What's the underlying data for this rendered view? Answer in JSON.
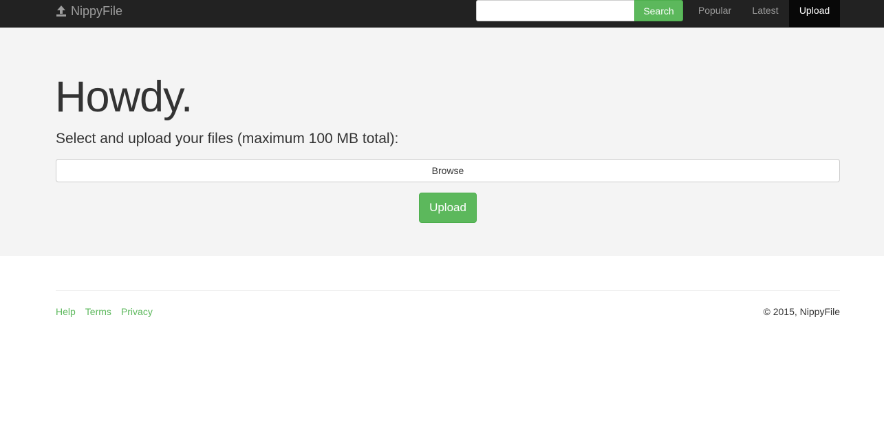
{
  "navbar": {
    "brand": "NippyFile",
    "search": {
      "value": "",
      "placeholder": "",
      "button_label": "Search"
    },
    "links": {
      "popular": "Popular",
      "latest": "Latest",
      "upload": "Upload"
    },
    "active_link": "upload"
  },
  "hero": {
    "headline": "Howdy.",
    "lead": "Select and upload your files (maximum 100 MB total):",
    "browse_label": "Browse",
    "upload_label": "Upload"
  },
  "footer": {
    "links": {
      "help": "Help",
      "terms": "Terms",
      "privacy": "Privacy"
    },
    "copyright": "© 2015, NippyFile"
  },
  "colors": {
    "navbar_bg": "#222222",
    "accent_green": "#5cb85c",
    "hero_bg": "#f4f4f4",
    "text": "#333333",
    "nav_muted": "#9d9d9d"
  },
  "icons": {
    "brand": "upload-icon"
  }
}
